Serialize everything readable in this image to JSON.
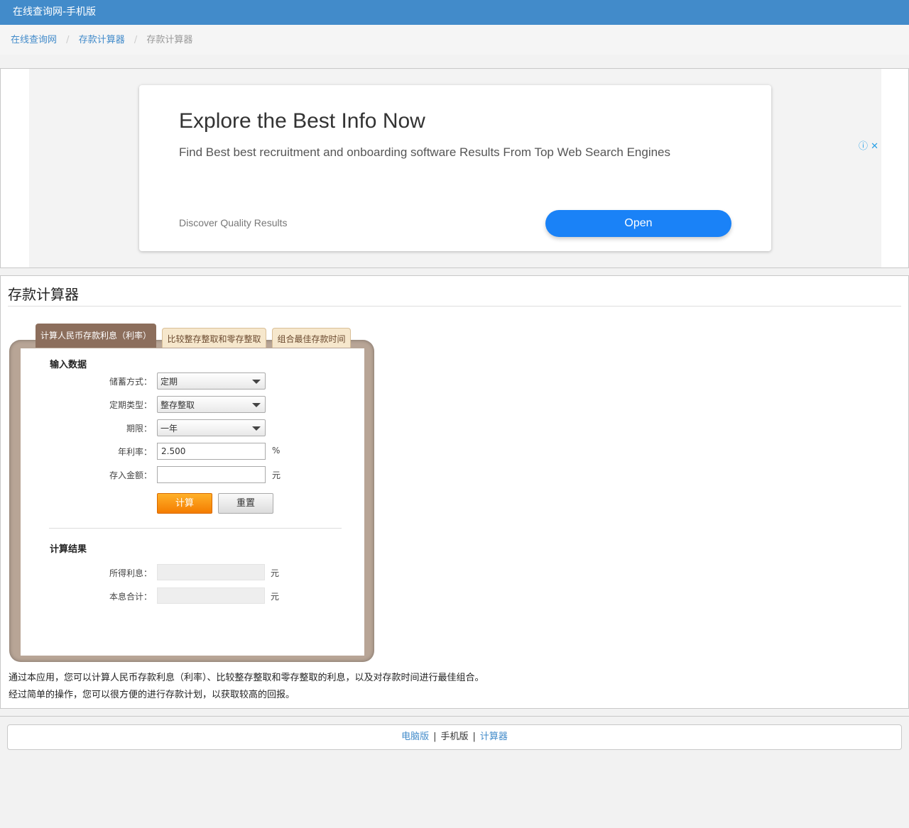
{
  "topbar": {
    "title": "在线查询网-手机版"
  },
  "breadcrumb": {
    "items": [
      "在线查询网",
      "存款计算器"
    ],
    "current": "存款计算器",
    "separator": "/"
  },
  "ad": {
    "title": "Explore the Best Info Now",
    "description": "Find Best best recruitment and onboarding software Results From Top Web Search Engines",
    "subtext": "Discover Quality Results",
    "button": "Open",
    "info_icon": "ⓘ",
    "close_icon": "✕"
  },
  "panel": {
    "title": "存款计算器",
    "tabs": [
      "计算人民币存款利息（利率）",
      "比较整存整取和零存整取",
      "组合最佳存款时间"
    ],
    "input_section": "输入数据",
    "fields": {
      "savings_type": {
        "label": "储蓄方式：",
        "value": "定期"
      },
      "fixed_type": {
        "label": "定期类型：",
        "value": "整存整取"
      },
      "term": {
        "label": "期限：",
        "value": "一年"
      },
      "rate": {
        "label": "年利率：",
        "value": "2.500",
        "unit": "%"
      },
      "amount": {
        "label": "存入金额：",
        "value": "",
        "unit": "元"
      }
    },
    "buttons": {
      "calc": "计算",
      "reset": "重置"
    },
    "result_section": "计算结果",
    "results": {
      "interest": {
        "label": "所得利息：",
        "unit": "元"
      },
      "total": {
        "label": "本息合计：",
        "unit": "元"
      }
    },
    "description": [
      "通过本应用，您可以计算人民币存款利息（利率）、比较整存整取和零存整取的利息，以及对存款时间进行最佳组合。",
      "经过简单的操作，您可以很方便的进行存款计划，以获取较高的回报。"
    ]
  },
  "footer": {
    "links": [
      "电脑版",
      "手机版",
      "计算器"
    ],
    "separator": "|"
  }
}
